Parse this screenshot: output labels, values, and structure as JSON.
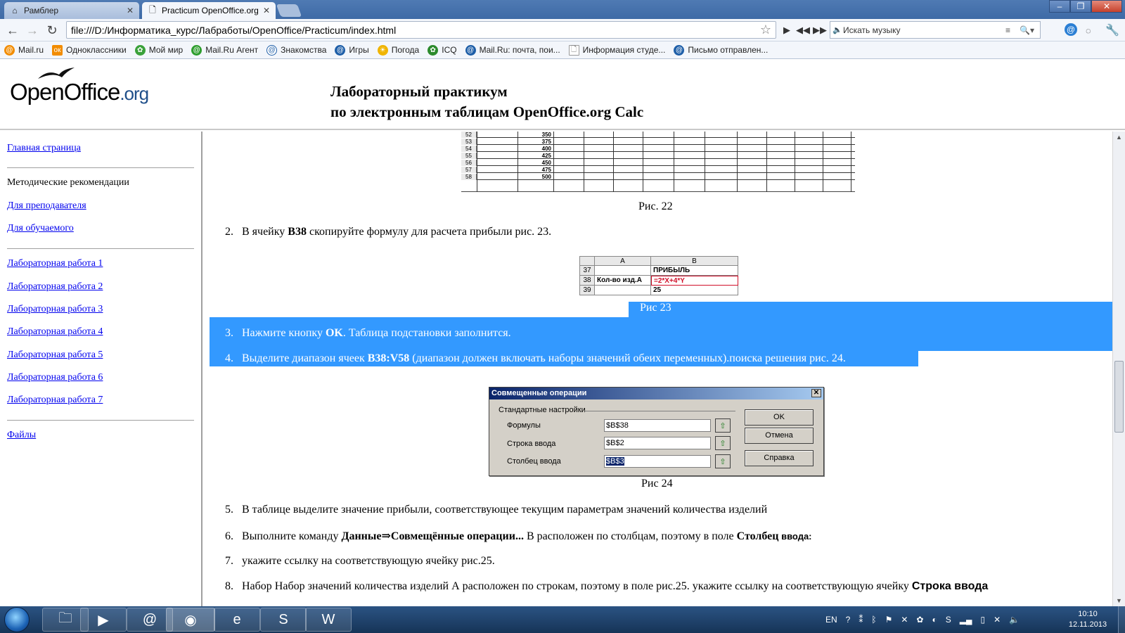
{
  "browser": {
    "tabs": [
      {
        "title": "Рамблер",
        "active": false
      },
      {
        "title": "Practicum OpenOffice.org",
        "active": true
      }
    ],
    "url": "file:///D:/Информатика_курс/Лабработы/OpenOffice/Practicum/index.html",
    "music_search_placeholder": "Искать музыку",
    "bookmarks": [
      {
        "label": "Mail.ru",
        "color": "#f28c00"
      },
      {
        "label": "Одноклассники",
        "color": "#f28c00"
      },
      {
        "label": "Мой мир",
        "color": "#3aa13a"
      },
      {
        "label": "Mail.Ru Агент",
        "color": "#2f9e2f"
      },
      {
        "label": "Знакомства",
        "color": "#1f5fa8"
      },
      {
        "label": "Игры",
        "color": "#1f5fa8"
      },
      {
        "label": "Погода",
        "color": "#f0b400"
      },
      {
        "label": "ICQ",
        "color": "#2c8a2c"
      },
      {
        "label": "Mail.Ru: почта, пои...",
        "color": "#1f5fa8"
      },
      {
        "label": "Информация студе...",
        "color": "#9a9a9a"
      },
      {
        "label": "Письмо отправлен...",
        "color": "#1f5fa8"
      }
    ]
  },
  "header": {
    "logo": {
      "main": "OpenOffice",
      "suffix": ".org"
    },
    "title_line1": "Лабораторный практикум",
    "title_line2": "по электронным таблицам OpenOffice.org Calc"
  },
  "sidebar": {
    "home": "Главная страница",
    "methodics": "Методические рекомендации",
    "teacher": "Для преподавателя",
    "student": "Для обучаемого",
    "labs": [
      "Лабораторная работа 1",
      "Лабораторная работа 2",
      "Лабораторная работа 3",
      "Лабораторная работа 4",
      "Лабораторная работа 5",
      "Лабораторная работа 6",
      "Лабораторная работа 7"
    ],
    "files": "Файлы"
  },
  "content": {
    "sheet1_rows": [
      {
        "num": "52",
        "val": "350"
      },
      {
        "num": "53",
        "val": "375"
      },
      {
        "num": "54",
        "val": "400"
      },
      {
        "num": "55",
        "val": "425"
      },
      {
        "num": "56",
        "val": "450"
      },
      {
        "num": "57",
        "val": "475"
      },
      {
        "num": "58",
        "val": "500"
      }
    ],
    "fig22": "Рис. 22",
    "step2": {
      "num": "2.",
      "pre": "В ячейку ",
      "bold": "B38",
      "post": " скопируйте формулу для расчета прибыли рис. 23."
    },
    "sheet2": {
      "col_a": "A",
      "col_b": "B",
      "r37": "37",
      "r38": "38",
      "r39": "39",
      "b37": "ПРИБЫЛЬ",
      "a38": "Кол-во изд.А",
      "b38": "=2*X+4*Y",
      "b39": "25"
    },
    "fig23": "Рис 23",
    "step3": {
      "num": "3.",
      "pre": "Нажмите кнопку ",
      "bold": "OK",
      "post": ". Таблица подстановки заполнится."
    },
    "step4": {
      "num": "4.",
      "pre": "Выделите диапазон ячеек ",
      "bold": "B38:V58",
      "post": " (диапазон должен включать наборы значений обеих переменных).поиска решения рис. 24."
    },
    "dialog": {
      "title": "Совмещенные операции",
      "group": "Стандартные настройки",
      "formulas_label": "Формулы",
      "formulas_value": "$B$38",
      "row_label": "Строка ввода",
      "row_value": "$B$2",
      "col_label": "Столбец ввода",
      "col_value": "$B$3",
      "ok": "OK",
      "cancel": "Отмена",
      "help": "Справка"
    },
    "fig24": "Рис 24",
    "step5": {
      "num": "5.",
      "text": "В таблице выделите значение прибыли, соответствующее текущим параметрам значений количества изделий"
    },
    "step6": {
      "num": "6.",
      "pre": "Выполните команду ",
      "bold1": "Данные⇒Совмещённые операции...",
      "mid": " В расположен по столбцам, поэтому в поле ",
      "bold2": "Столбец",
      "bold3": " ввода:"
    },
    "step7": {
      "num": "7.",
      "text": "укажите ссылку на соответствующую ячейку рис.25."
    },
    "step8": {
      "num": "8.",
      "pre": "Набор Набор значений количества изделий А расположен по строкам, поэтому в поле рис.25. укажите ссылку на соответствующую ячейку ",
      "bold": "Строка ввода"
    }
  },
  "taskbar": {
    "lang": "EN",
    "time": "10:10",
    "date": "12.11.2013"
  }
}
